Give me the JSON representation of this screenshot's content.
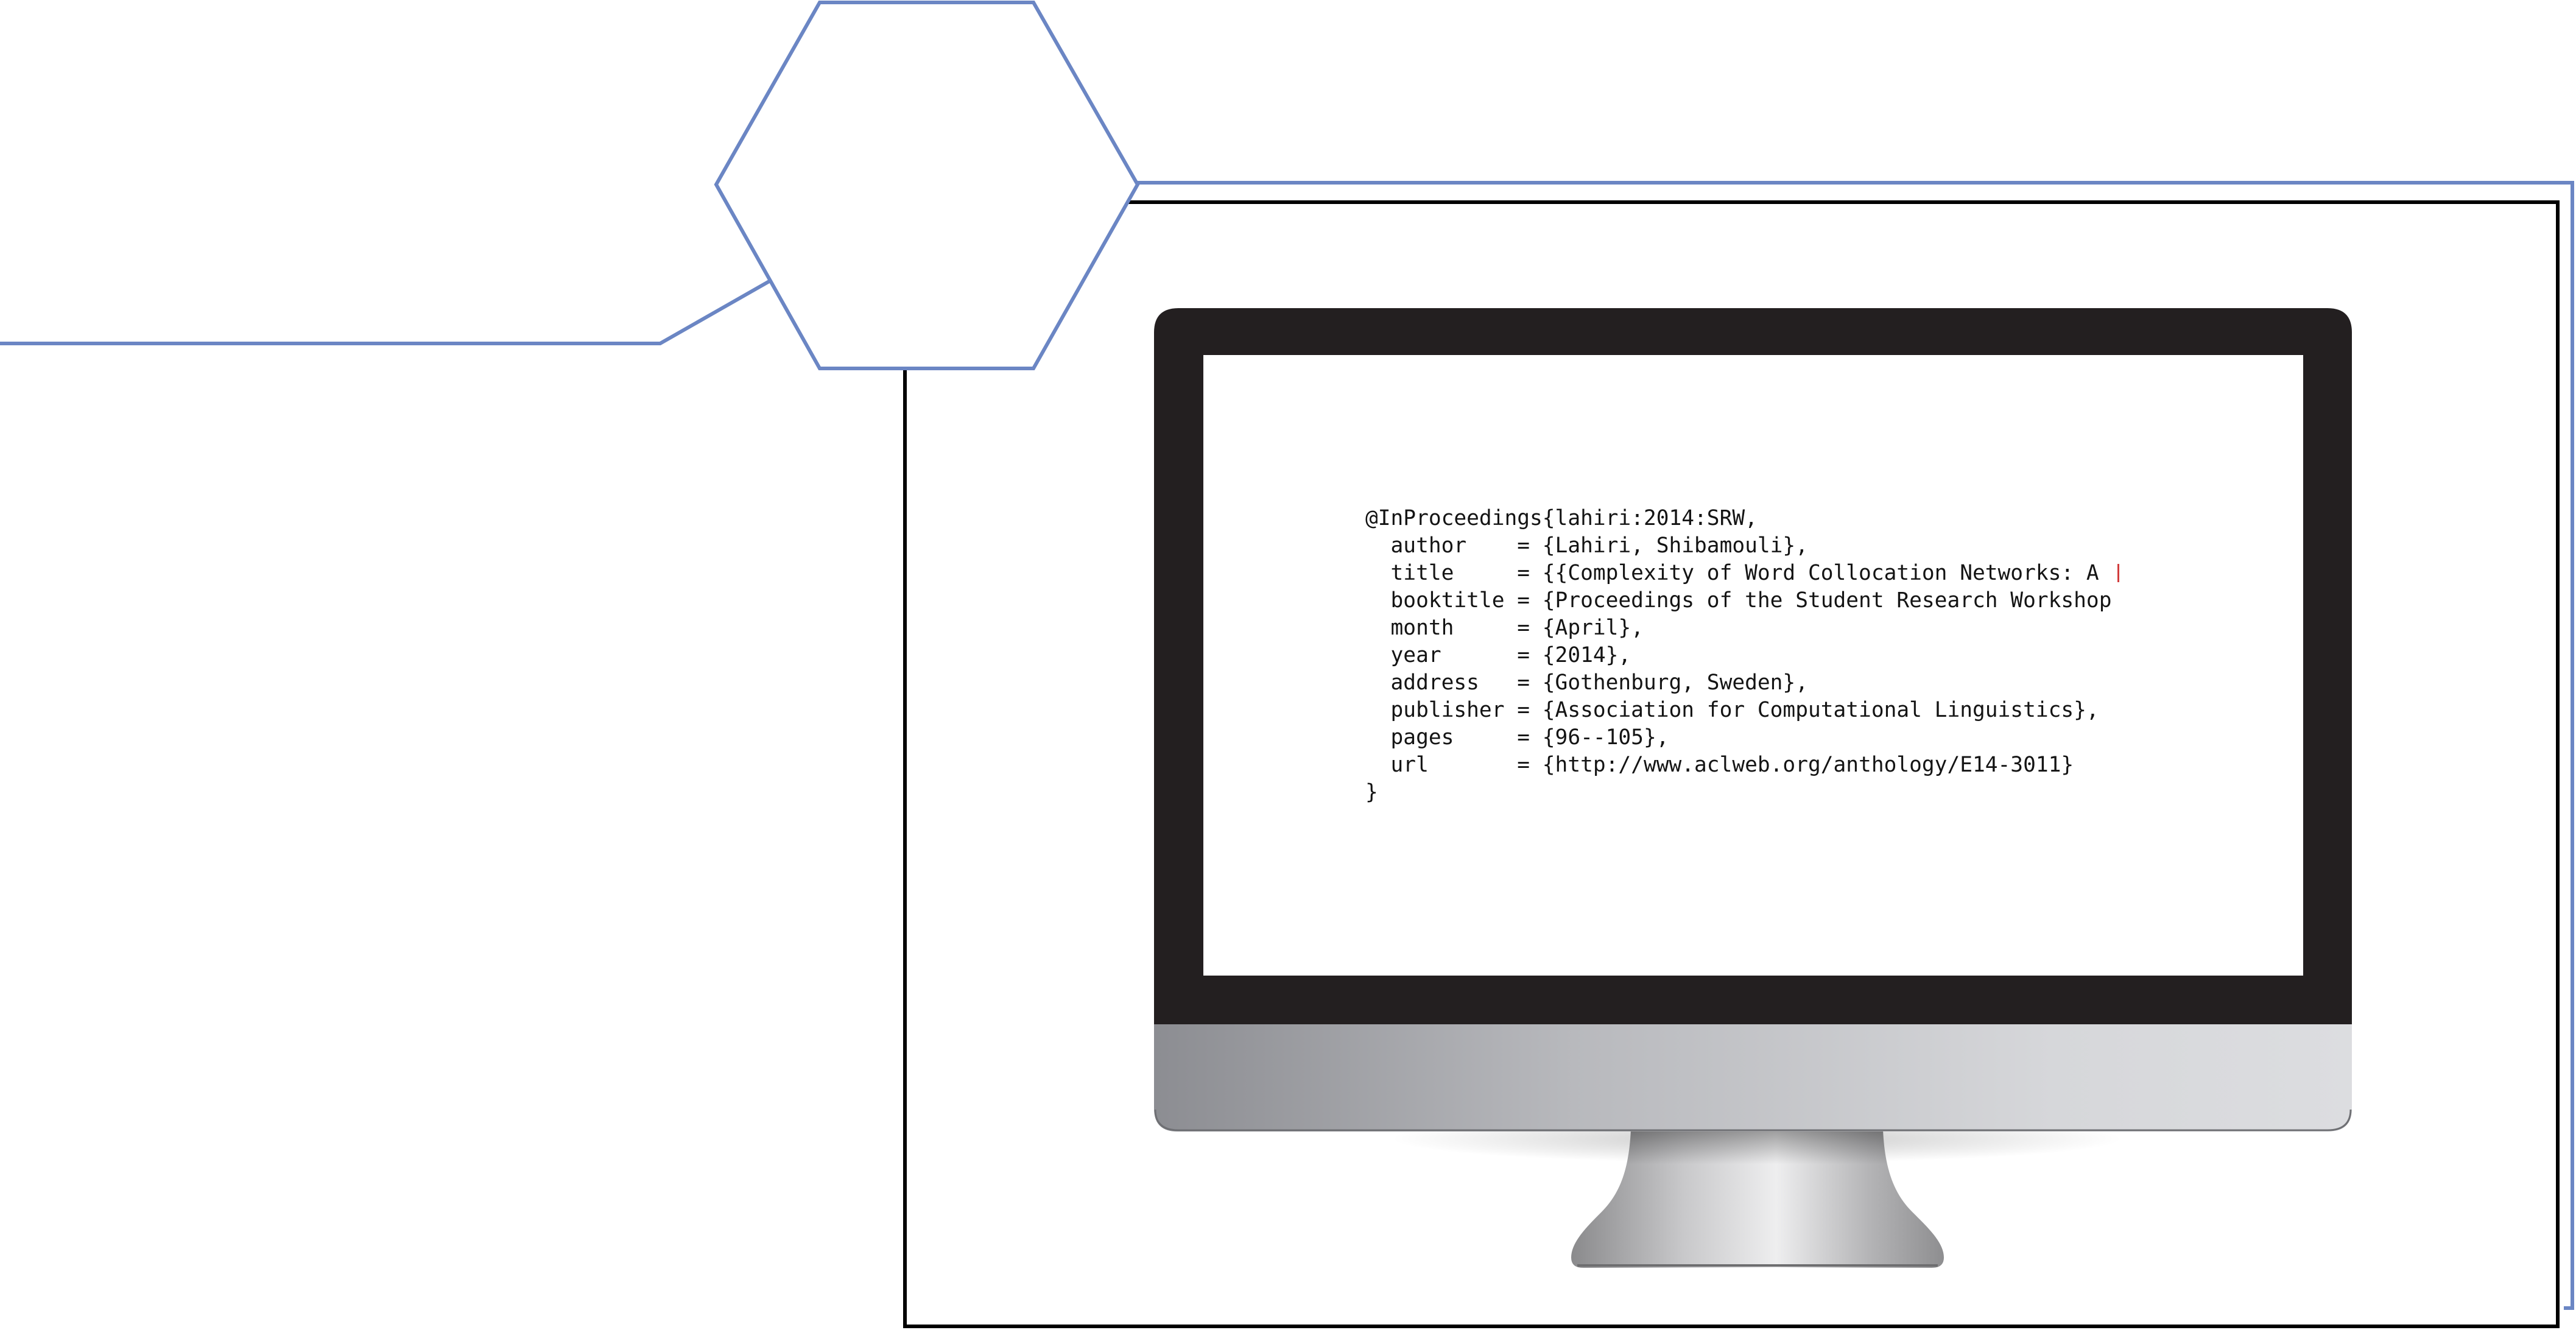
{
  "colors": {
    "hexagon_and_connector": "#6b86c4",
    "outer_frame": "#000000",
    "monitor_bezel": "#231f20",
    "screen_background": "#ffffff",
    "text": "#141414",
    "text_cursor": "#d23c3c"
  },
  "screen": {
    "bibtex_lines": [
      "@InProceedings{lahiri:2014:SRW,",
      "  author    = {Lahiri, Shibamouli},",
      "  title     = {{Complexity of Word Collocation Networks: A ",
      "  booktitle = {Proceedings of the Student Research Workshop",
      "  month     = {April},",
      "  year      = {2014},",
      "  address   = {Gothenburg, Sweden},",
      "  publisher = {Association for Computational Linguistics},",
      "  pages     = {96--105},",
      "  url       = {http://www.aclweb.org/anthology/E14-3011}",
      "}"
    ]
  }
}
